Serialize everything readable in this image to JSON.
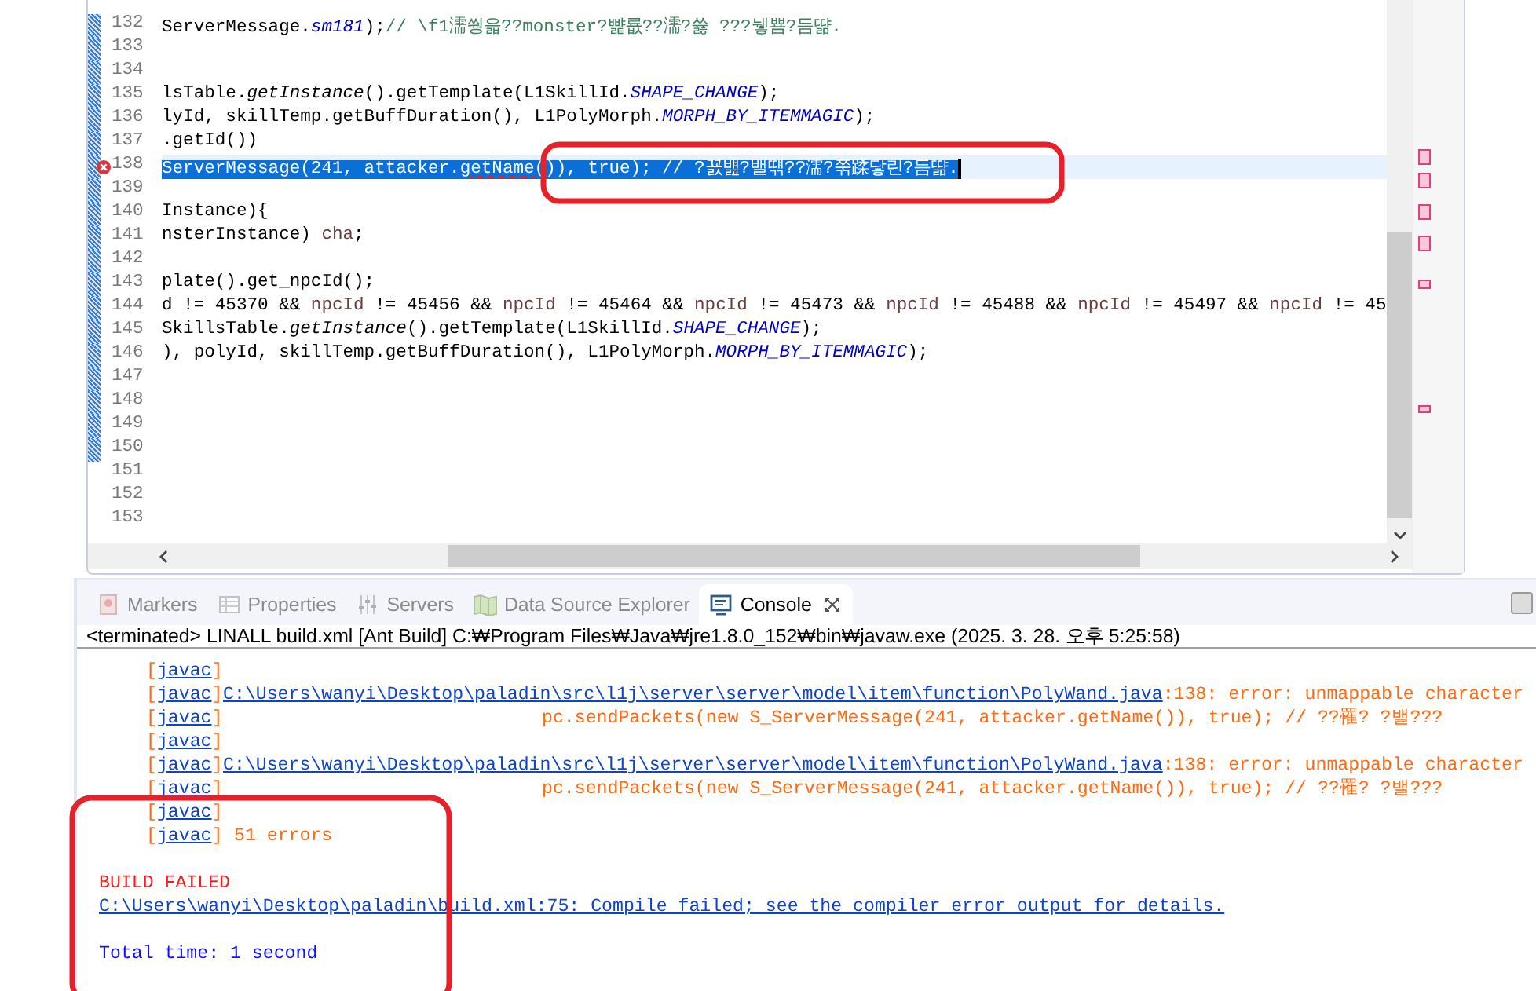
{
  "editor": {
    "lines": [
      {
        "number": "132",
        "changed": true,
        "selected": false,
        "error": false,
        "segments": [
          {
            "kind": "plain",
            "text": "ServerMessage."
          },
          {
            "kind": "constant",
            "text": "sm181"
          },
          {
            "kind": "plain",
            "text": ");"
          },
          {
            "kind": "comment",
            "text": "// \\f1濡쒕읇??monster?뺥룞??濡?쓣 ???뉗뿀?듬땲."
          }
        ]
      },
      {
        "number": "133",
        "changed": true,
        "selected": false,
        "error": false
      },
      {
        "number": "134",
        "changed": true,
        "selected": false,
        "error": false
      },
      {
        "number": "135",
        "changed": true,
        "selected": false,
        "error": false,
        "segments": [
          {
            "kind": "plain",
            "text": "lsTable."
          },
          {
            "kind": "static-method",
            "text": "getInstance"
          },
          {
            "kind": "plain",
            "text": "().getTemplate(L1SkillId."
          },
          {
            "kind": "constant",
            "text": "SHAPE_CHANGE"
          },
          {
            "kind": "plain",
            "text": ");"
          }
        ]
      },
      {
        "number": "136",
        "changed": true,
        "selected": false,
        "error": false,
        "segments": [
          {
            "kind": "plain",
            "text": "lyId, skillTemp.getBuffDuration(), L1PolyMorph."
          },
          {
            "kind": "constant",
            "text": "MORPH_BY_ITEMMAGIC"
          },
          {
            "kind": "plain",
            "text": ");"
          }
        ]
      },
      {
        "number": "137",
        "changed": true,
        "selected": false,
        "error": false,
        "segments": [
          {
            "kind": "plain",
            "text": ".getId())"
          }
        ]
      },
      {
        "number": "138",
        "changed": true,
        "selected": true,
        "error": true,
        "segments": [
          {
            "kind": "plain",
            "text": "ServerMessage(241, attacker."
          },
          {
            "kind": "squiggle",
            "text": "getName"
          },
          {
            "kind": "plain",
            "text": "()), true); // ?꾨뱶?밸떆??濡?쭊蹂닿린?듬땲."
          }
        ]
      },
      {
        "number": "139",
        "changed": true,
        "selected": false,
        "error": false
      },
      {
        "number": "140",
        "changed": true,
        "selected": false,
        "error": false,
        "segments": [
          {
            "kind": "plain",
            "text": "Instance){"
          }
        ]
      },
      {
        "number": "141",
        "changed": true,
        "selected": false,
        "error": false,
        "segments": [
          {
            "kind": "plain",
            "text": "nsterInstance) "
          },
          {
            "kind": "local",
            "text": "cha"
          },
          {
            "kind": "plain",
            "text": ";"
          }
        ]
      },
      {
        "number": "142",
        "changed": true,
        "selected": false,
        "error": false
      },
      {
        "number": "143",
        "changed": true,
        "selected": false,
        "error": false,
        "segments": [
          {
            "kind": "plain",
            "text": "plate().get_npcId();"
          }
        ]
      },
      {
        "number": "144",
        "changed": true,
        "selected": false,
        "error": false,
        "segments": [
          {
            "kind": "plain",
            "text": "d != 45370 && "
          },
          {
            "kind": "local",
            "text": "npcId"
          },
          {
            "kind": "plain",
            "text": " != 45456 && "
          },
          {
            "kind": "local",
            "text": "npcId"
          },
          {
            "kind": "plain",
            "text": " != 45464 && "
          },
          {
            "kind": "local",
            "text": "npcId"
          },
          {
            "kind": "plain",
            "text": " != 45473 && "
          },
          {
            "kind": "local",
            "text": "npcId"
          },
          {
            "kind": "plain",
            "text": " != 45488 && "
          },
          {
            "kind": "local",
            "text": "npcId"
          },
          {
            "kind": "plain",
            "text": " != 45497 && "
          },
          {
            "kind": "local",
            "text": "npcId"
          },
          {
            "kind": "plain",
            "text": " != 45"
          }
        ]
      },
      {
        "number": "145",
        "changed": true,
        "selected": false,
        "error": false,
        "segments": [
          {
            "kind": "plain",
            "text": "SkillsTable."
          },
          {
            "kind": "static-method",
            "text": "getInstance"
          },
          {
            "kind": "plain",
            "text": "().getTemplate(L1SkillId."
          },
          {
            "kind": "constant",
            "text": "SHAPE_CHANGE"
          },
          {
            "kind": "plain",
            "text": ");"
          }
        ]
      },
      {
        "number": "146",
        "changed": true,
        "selected": false,
        "error": false,
        "segments": [
          {
            "kind": "plain",
            "text": "), polyId, skillTemp.getBuffDuration(), L1PolyMorph."
          },
          {
            "kind": "constant",
            "text": "MORPH_BY_ITEMMAGIC"
          },
          {
            "kind": "plain",
            "text": ");"
          }
        ]
      },
      {
        "number": "147",
        "changed": true,
        "selected": false,
        "error": false
      },
      {
        "number": "148",
        "changed": true,
        "selected": false,
        "error": false
      },
      {
        "number": "149",
        "changed": true,
        "selected": false,
        "error": false
      },
      {
        "number": "150",
        "changed": true,
        "selected": false,
        "error": false
      },
      {
        "number": "151",
        "changed": false,
        "selected": false,
        "error": false
      },
      {
        "number": "152",
        "changed": false,
        "selected": false,
        "error": false
      },
      {
        "number": "153",
        "changed": false,
        "selected": false,
        "error": false
      }
    ]
  },
  "panel": {
    "tabs": [
      {
        "label": "Markers",
        "selected": false
      },
      {
        "label": "Properties",
        "selected": false
      },
      {
        "label": "Servers",
        "selected": false
      },
      {
        "label": "Data Source Explorer",
        "selected": false
      },
      {
        "label": "Console",
        "selected": true
      }
    ],
    "console": {
      "header": "<terminated> LINALL build.xml [Ant Build] C:₩Program Files₩Java₩jre1.8.0_152₩bin₩javaw.exe (2025. 3. 28. 오후 5:25:58)",
      "lines": [
        {
          "kind": "tag-only",
          "tag": "[javac]"
        },
        {
          "kind": "path",
          "tag": "[javac]",
          "link": "C:\\Users\\wanyi\\Desktop\\paladin\\src\\l1j\\server\\server\\model\\item\\function\\PolyWand.java",
          "text": ":138: error: unmappable character"
        },
        {
          "kind": "source",
          "tag": "[javac]",
          "text": "pc.sendPackets(new S_ServerMessage(241, attacker.getName()), true); // ??罹? ?밸???"
        },
        {
          "kind": "tag-only",
          "tag": "[javac]"
        },
        {
          "kind": "path",
          "tag": "[javac]",
          "link": "C:\\Users\\wanyi\\Desktop\\paladin\\src\\l1j\\server\\server\\model\\item\\function\\PolyWand.java",
          "text": ":138: error: unmappable character"
        },
        {
          "kind": "source",
          "tag": "[javac]",
          "text": "pc.sendPackets(new S_ServerMessage(241, attacker.getName()), true); // ??罹? ?밸???"
        },
        {
          "kind": "tag-only",
          "tag": "[javac]"
        },
        {
          "kind": "summary",
          "tag": "[javac]",
          "text": "51 errors"
        },
        {
          "kind": "blank"
        },
        {
          "kind": "failed",
          "text": "BUILD FAILED"
        },
        {
          "kind": "link",
          "link": "C:\\Users\\wanyi\\Desktop\\paladin\\build.xml:75: Compile failed; see the compiler error output for details."
        },
        {
          "kind": "blank"
        },
        {
          "kind": "info",
          "text": "Total time: 1 second"
        }
      ]
    }
  }
}
